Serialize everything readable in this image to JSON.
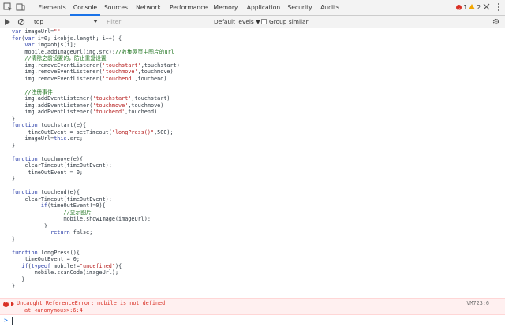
{
  "toolbar": {
    "tabs": [
      "Elements",
      "Console",
      "Sources",
      "Network",
      "Performance",
      "Memory",
      "Application",
      "Security",
      "Audits"
    ],
    "active_tab": "Console",
    "error_count": "1",
    "warning_count": "2"
  },
  "filterbar": {
    "context": "top",
    "filter_placeholder": "Filter",
    "levels": "Default levels ▼",
    "group_similar": "Group similar"
  },
  "console": {
    "code_lines": [
      "var imageUrl=\"\"",
      "for(var i=0; i<objs.length; i++) {",
      "    var img=objs[i];",
      "    mobile.addImageUrl(img.src);//收集网页中图片的url",
      "    //清除之前设置的，防止重复设置",
      "    img.removeEventListener('touchstart',touchstart)",
      "    img.removeEventListener('touchmove',touchmove)",
      "    img.removeEventListener('touchend',touchend)",
      "",
      "    //注册事件",
      "    img.addEventListener('touchstart',touchstart)",
      "    img.addEventListener('touchmove',touchmove)",
      "    img.addEventListener('touchend',touchend)",
      "}",
      "function touchstart(e){",
      "     timeOutEvent = setTimeout(\"longPress()\",500);",
      "    imageUrl=this.src;",
      "}",
      "",
      "function touchmove(e){",
      "    clearTimeout(timeOutEvent);",
      "     timeOutEvent = 0;",
      "}",
      "",
      "function touchend(e){",
      "    clearTimeout(timeOutEvent);",
      "         if(timeOutEvent!=0){",
      "                //显示图片",
      "                mobile.showImage(imageUrl);",
      "          }",
      "            return false;",
      "}",
      "",
      "function longPress(){",
      "    timeOutEvent = 0;",
      "   if(typeof mobile!=\"undefined\"){",
      "       mobile.scanCode(imageUrl);",
      "   }",
      "}"
    ],
    "error": {
      "message": "Uncaught ReferenceError: mobile is not defined",
      "location": "at <anonymous>:6:4",
      "source": "VM723:6"
    }
  },
  "colors": {
    "accent": "#1a73e8",
    "error": "#d93025",
    "keyword": "#2a3ea8",
    "string": "#b51d1d",
    "comment": "#227622"
  }
}
